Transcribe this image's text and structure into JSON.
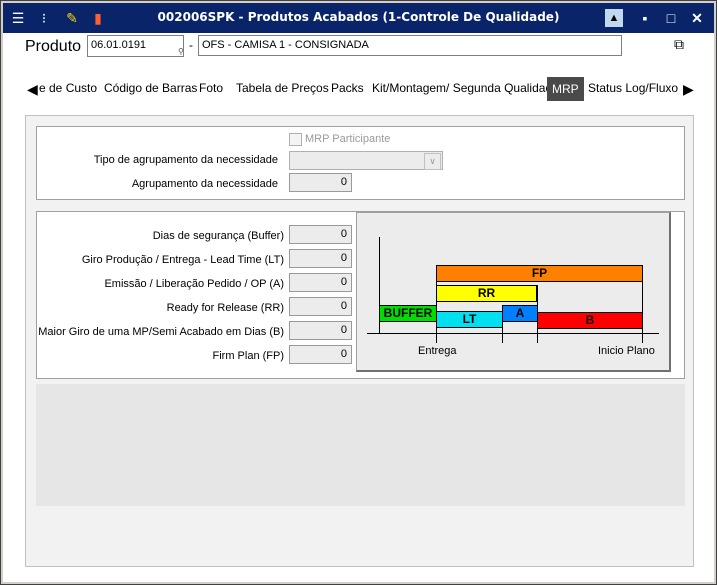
{
  "window": {
    "title": "002006SPK - Produtos Acabados (1-Controle De Qualidade)",
    "minimize": "▪",
    "maximize": "□",
    "close": "✕"
  },
  "header": {
    "produto_label": "Produto",
    "codigo_value": "06.01.0191",
    "separator": "-",
    "descricao_value": "OFS - CAMISA 1 - CONSIGNADA"
  },
  "tabs": [
    {
      "label": "e de Custo"
    },
    {
      "label": "Código de Barras"
    },
    {
      "label": "Foto"
    },
    {
      "label": "Tabela de Preços"
    },
    {
      "label": "Packs"
    },
    {
      "label": "Kit/Montagem/ Segunda Qualidade"
    },
    {
      "label": "MRP"
    },
    {
      "label": "Status Log/Fluxo"
    }
  ],
  "mrp": {
    "participante_label": "MRP Participante",
    "participante_checked": false,
    "tipo_label": "Tipo de agrupamento da necessidade",
    "tipo_value": "",
    "agrup_label": "Agrupamento da necessidade",
    "agrup_value": "0"
  },
  "params": [
    {
      "label": "Dias de segurança (Buffer)",
      "value": "0"
    },
    {
      "label": "Giro Produção / Entrega - Lead Time (LT)",
      "value": "0"
    },
    {
      "label": "Emissão / Liberação Pedido / OP (A)",
      "value": "0"
    },
    {
      "label": "Ready for Release (RR)",
      "value": "0"
    },
    {
      "label": "Maior Giro de uma MP/Semi Acabado em Dias (B)",
      "value": "0"
    },
    {
      "label": "Firm Plan (FP)",
      "value": "0"
    }
  ],
  "diagram": {
    "fp": "FP",
    "rr": "RR",
    "buffer": "BUFFER",
    "lt": "LT",
    "a": "A",
    "b": "B",
    "entrega": "Entrega",
    "inicio": "Inicio Plano",
    "colors": {
      "fp": "#ff8000",
      "rr": "#ffff00",
      "buffer": "#00dd00",
      "lt": "#00e0f0",
      "a": "#0080ff",
      "b": "#ff0000"
    }
  }
}
